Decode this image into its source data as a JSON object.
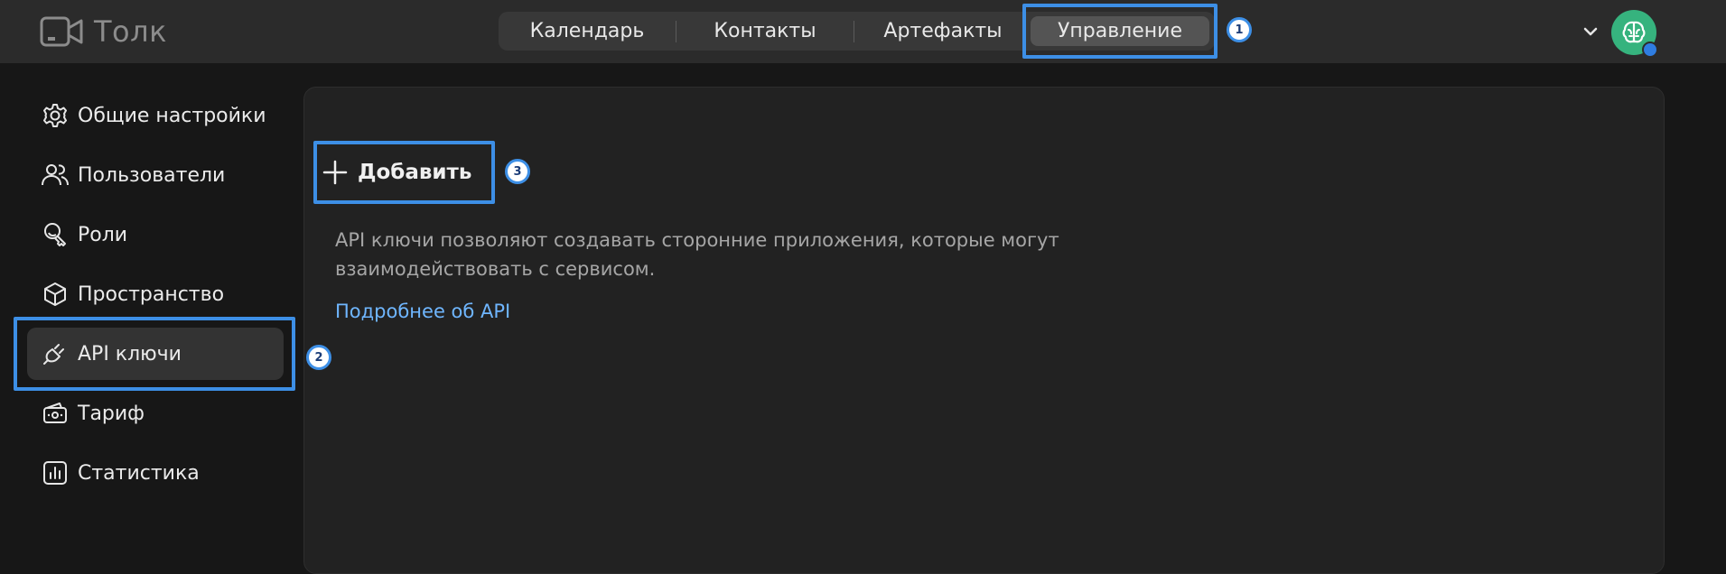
{
  "app": {
    "name": "Толк"
  },
  "tabs": [
    {
      "label": "Календарь"
    },
    {
      "label": "Контакты"
    },
    {
      "label": "Артефакты"
    },
    {
      "label": "Управление",
      "active": true
    }
  ],
  "sidebar": {
    "items": [
      {
        "label": "Общие настройки",
        "icon": "gear-icon"
      },
      {
        "label": "Пользователи",
        "icon": "users-icon"
      },
      {
        "label": "Роли",
        "icon": "roles-icon"
      },
      {
        "label": "Пространство",
        "icon": "cube-icon"
      },
      {
        "label": "API ключи",
        "icon": "plug-icon",
        "active": true
      },
      {
        "label": "Тариф",
        "icon": "wallet-icon"
      },
      {
        "label": "Статистика",
        "icon": "chart-icon"
      }
    ]
  },
  "main": {
    "add_label": "Добавить",
    "description_line1": "API ключи позволяют создавать сторонние приложения, которые могут",
    "description_line2": "взаимодействовать с сервисом.",
    "link_label": "Подробнее об API"
  },
  "annotations": {
    "badge1": "1",
    "badge2": "2",
    "badge3": "3"
  },
  "colors": {
    "highlight": "#3d8fe6",
    "link": "#6fb6ff",
    "avatar": "#36b37e"
  }
}
